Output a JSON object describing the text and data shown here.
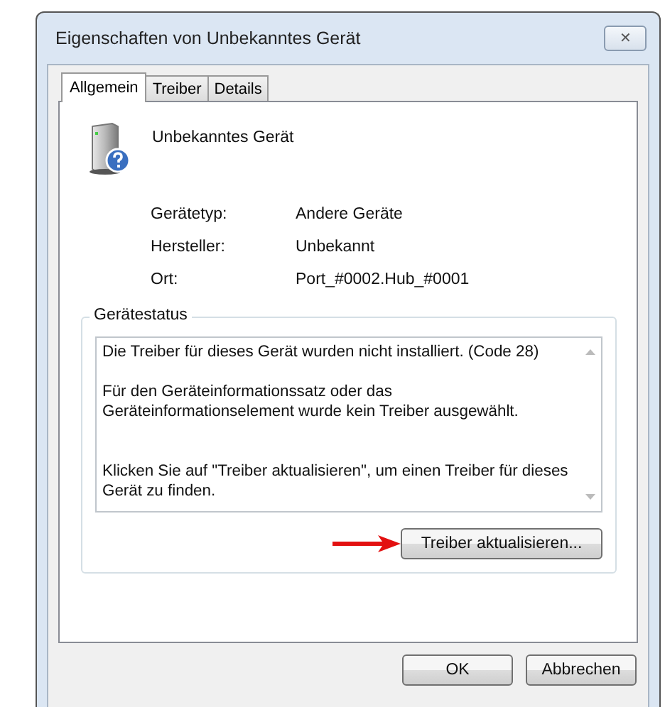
{
  "window": {
    "title": "Eigenschaften von Unbekanntes Gerät",
    "close": "✕"
  },
  "tabs": [
    {
      "label": "Allgemein",
      "selected": true
    },
    {
      "label": "Treiber",
      "selected": false
    },
    {
      "label": "Details",
      "selected": false
    }
  ],
  "device": {
    "name": "Unbekanntes Gerät"
  },
  "properties": [
    {
      "label": "Gerätetyp:",
      "value": "Andere Geräte"
    },
    {
      "label": "Hersteller:",
      "value": "Unbekannt"
    },
    {
      "label": "Ort:",
      "value": "Port_#0002.Hub_#0001"
    }
  ],
  "status": {
    "title": "Gerätestatus",
    "paragraphs": [
      "Die Treiber für dieses Gerät wurden nicht installiert. (Code 28)",
      "Für den Geräteinformationssatz oder das Geräteinformationselement wurde kein Treiber ausgewählt.",
      "Klicken Sie auf \"Treiber aktualisieren\", um einen Treiber für dieses Gerät zu finden."
    ],
    "button": "Treiber aktualisieren..."
  },
  "buttons": [
    "OK",
    "Abbrechen"
  ]
}
